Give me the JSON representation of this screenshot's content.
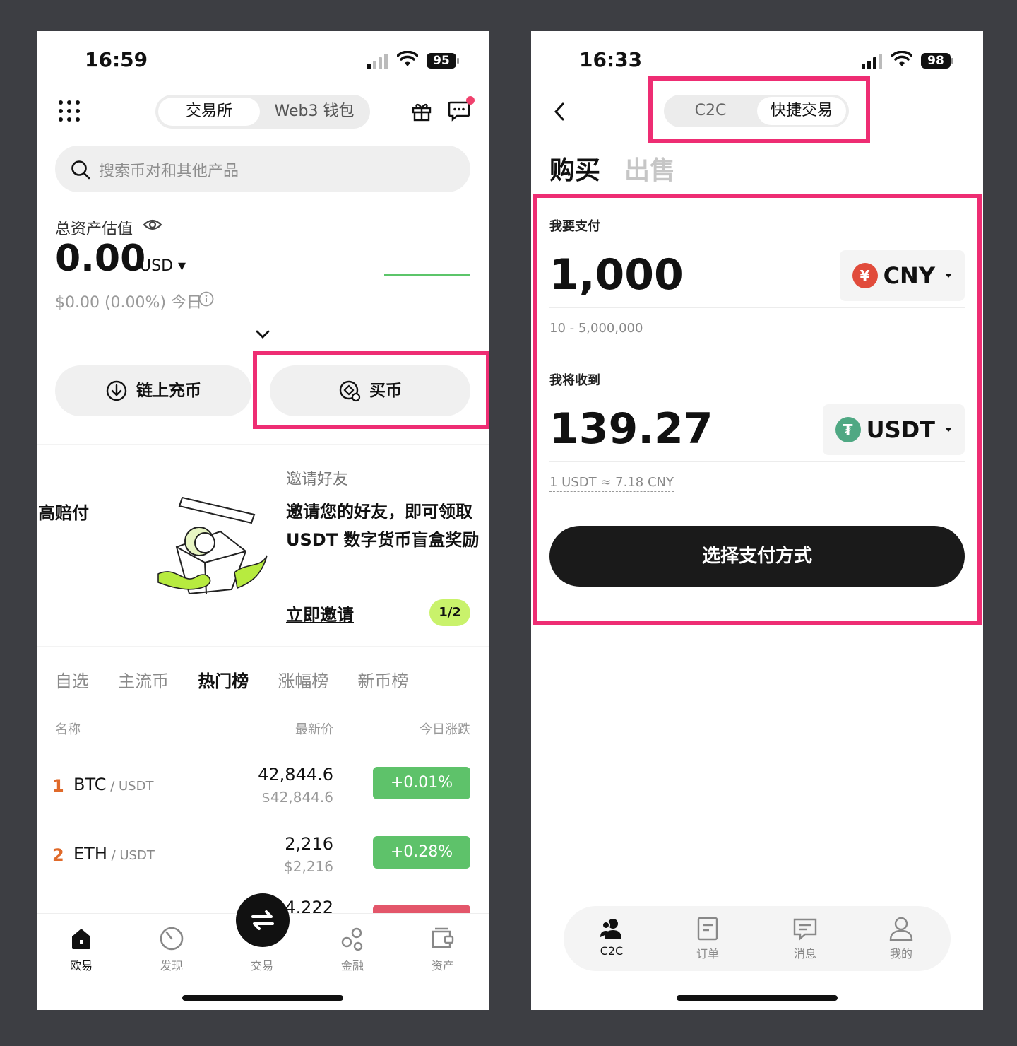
{
  "left": {
    "status": {
      "time": "16:59",
      "battery": "95"
    },
    "header": {
      "seg_exchange": "交易所",
      "seg_web3": "Web3 钱包"
    },
    "search": {
      "placeholder": "搜索币对和其他产品"
    },
    "assets": {
      "label": "总资产估值",
      "value": "0.00",
      "currency": "USD",
      "change": "$0.00 (0.00%) 今日"
    },
    "actions": {
      "deposit": "链上充币",
      "buy": "买币"
    },
    "promo": {
      "left_text": "高赔付",
      "kicker": "邀请好友",
      "title_line1": "邀请您的好友，即可领取",
      "title_line2": "USDT 数字货币盲盒奖励",
      "cta": "立即邀请",
      "pager": "1/2"
    },
    "market_tabs": [
      "自选",
      "主流币",
      "热门榜",
      "涨幅榜",
      "新币榜"
    ],
    "market_tab_active": "热门榜",
    "table_headers": {
      "name": "名称",
      "price": "最新价",
      "change": "今日涨跌"
    },
    "rows": [
      {
        "rank": "1",
        "symbol": "BTC",
        "pair": " / USDT",
        "price": "42,844.6",
        "fiat": "$42,844.6",
        "change": "+0.01%"
      },
      {
        "rank": "2",
        "symbol": "ETH",
        "pair": " / USDT",
        "price": "2,216",
        "fiat": "$2,216",
        "change": "+0.28%"
      }
    ],
    "partial_row_price": "4,222",
    "tabbar": {
      "home": "欧易",
      "discover": "发现",
      "trade": "交易",
      "finance": "金融",
      "assets": "资产"
    }
  },
  "right": {
    "status": {
      "time": "16:33",
      "battery": "98"
    },
    "header": {
      "seg_c2c": "C2C",
      "seg_express": "快捷交易"
    },
    "buy_sell": {
      "buy": "购买",
      "sell": "出售"
    },
    "pay": {
      "label": "我要支付",
      "amount": "1,000",
      "currency": "CNY",
      "currency_symbol": "¥",
      "range": "10 - 5,000,000"
    },
    "receive": {
      "label": "我将收到",
      "amount": "139.27",
      "currency": "USDT",
      "currency_symbol": "₮",
      "rate": "1 USDT ≈ 7.18 CNY"
    },
    "cta": "选择支付方式",
    "tabbar": {
      "c2c": "C2C",
      "orders": "订单",
      "messages": "消息",
      "me": "我的"
    }
  },
  "colors": {
    "highlight": "#ee2d73",
    "up_green": "#5ec26a",
    "cny_red": "#e14b3b",
    "usdt_green": "#4fa883",
    "promo_lime": "#c9f26b"
  },
  "icons": [
    "menu-dots-icon",
    "gift-icon",
    "chat-icon",
    "search-icon",
    "eye-icon",
    "info-icon",
    "chevron-down-icon",
    "download-icon",
    "buy-coin-icon",
    "gift-box-illustration",
    "home-icon",
    "discover-icon",
    "trade-swap-icon",
    "finance-icon",
    "wallet-icon",
    "back-icon",
    "c2c-users-icon",
    "orders-icon",
    "messages-icon",
    "profile-icon"
  ]
}
